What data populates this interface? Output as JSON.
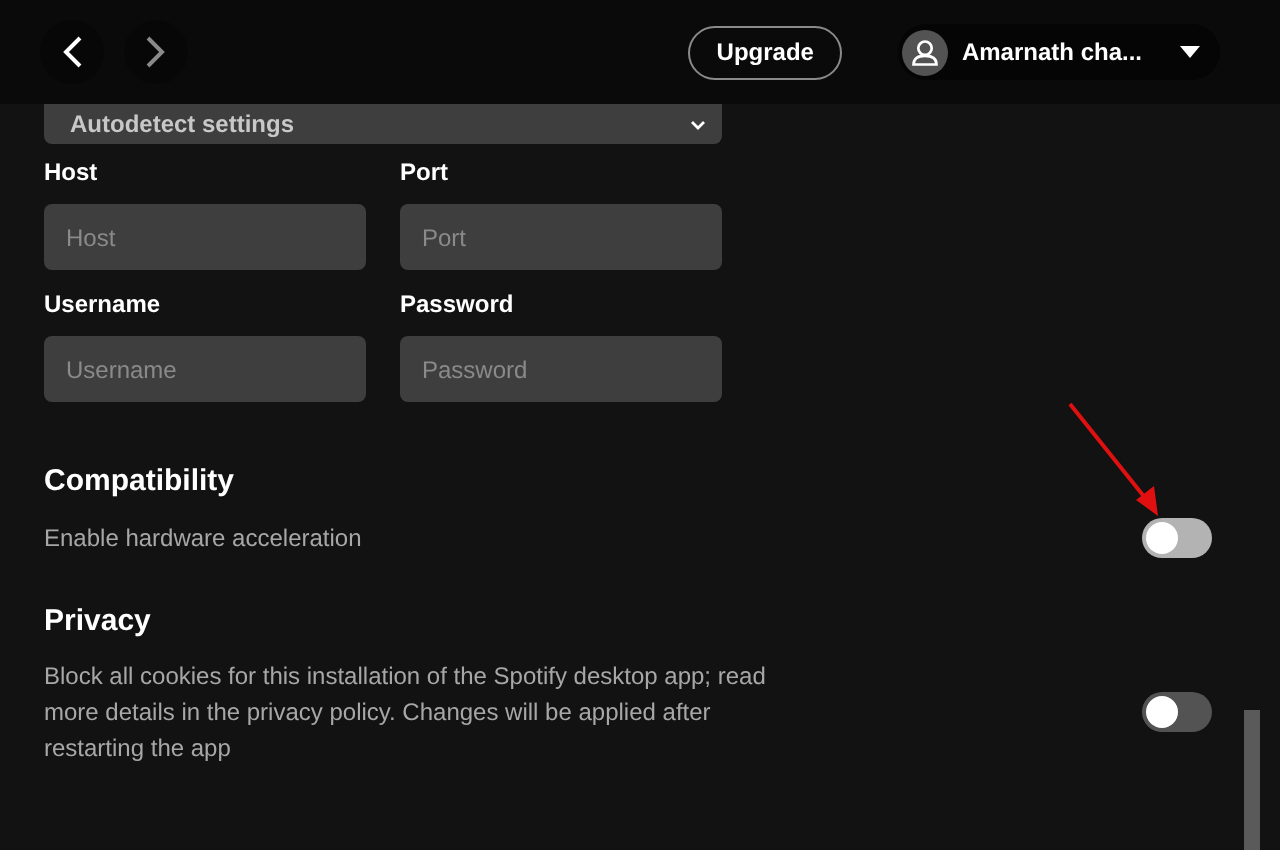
{
  "nav": {
    "back": {
      "disabled": false
    },
    "forward": {
      "disabled": true
    }
  },
  "upgrade_button": "Upgrade",
  "profile": {
    "name": "Amarnath cha..."
  },
  "proxy": {
    "select_value": "Autodetect settings",
    "fields": [
      {
        "label": "Host",
        "placeholder": "Host"
      },
      {
        "label": "Port",
        "placeholder": "Port"
      },
      {
        "label": "Username",
        "placeholder": "Username"
      },
      {
        "label": "Password",
        "placeholder": "Password"
      }
    ]
  },
  "sections": [
    {
      "title": "Compatibility",
      "description": "Enable hardware acceleration",
      "on": false,
      "hovered": true
    },
    {
      "title": "Privacy",
      "description": "Block all cookies for this installation of the Spotify desktop app; read more details in the privacy policy. Changes will be applied after restarting the app",
      "on": false,
      "hovered": false
    }
  ]
}
